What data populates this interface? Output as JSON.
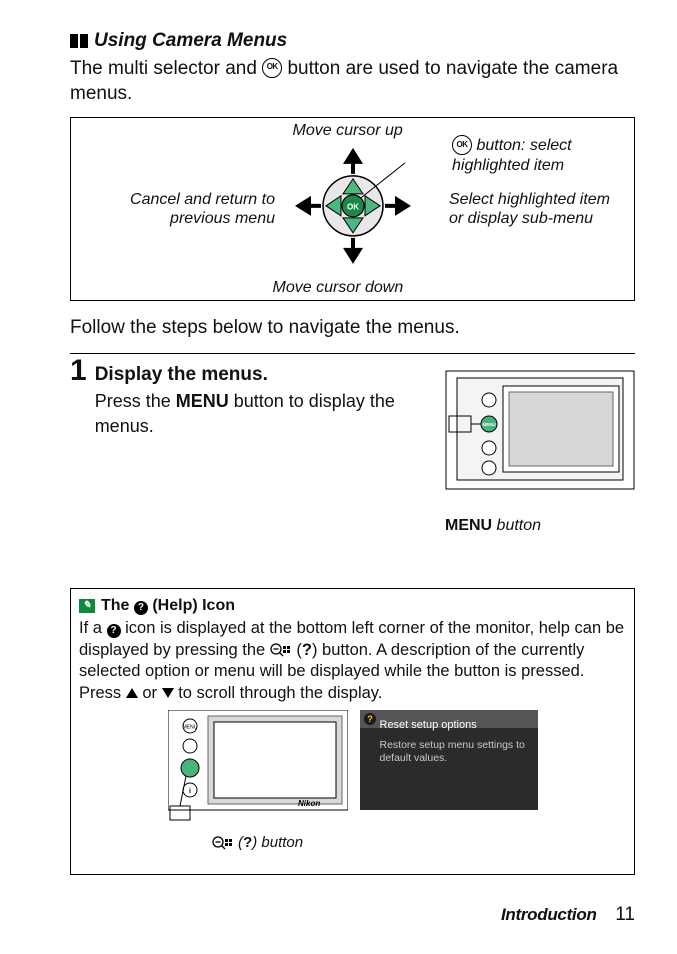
{
  "heading": "Using Camera Menus",
  "intro_pre": "The multi selector and ",
  "intro_post": " button are used to navigate the camera menus.",
  "nav": {
    "up": "Move cursor up",
    "down": "Move cursor down",
    "left": "Cancel and return to previous menu",
    "right": "Select highlighted item or display sub-menu",
    "ok": " button: select highlighted item"
  },
  "follow": "Follow the steps below to navigate the menus.",
  "step1": {
    "num": "1",
    "title": "Display the menus.",
    "pre": "Press the ",
    "menu": "MENU",
    "post": " button to display the menus."
  },
  "cam_caption_menu": "MENU",
  "cam_caption_rest": " button",
  "help": {
    "title_pre": "The ",
    "title_post": " (Help) Icon",
    "p1": "If a ",
    "p2": " icon is displayed at the bottom left corner of the monitor, help can be displayed by pressing the ",
    "p3": " (",
    "p4": ") button. A description of the currently selected option or menu will be displayed while the button is pressed. Press ",
    "p5": " or ",
    "p6": " to scroll through the display.",
    "q": "?",
    "screen_title": "Reset setup options",
    "screen_body": "Restore setup menu settings to default values.",
    "caption_pre": " (",
    "caption_q": "?",
    "caption_post": ") button"
  },
  "footer": {
    "section": "Introduction",
    "page": "11"
  },
  "ok_label": "OK",
  "brand": "Nikon",
  "cam_menu_btn": "MENU"
}
